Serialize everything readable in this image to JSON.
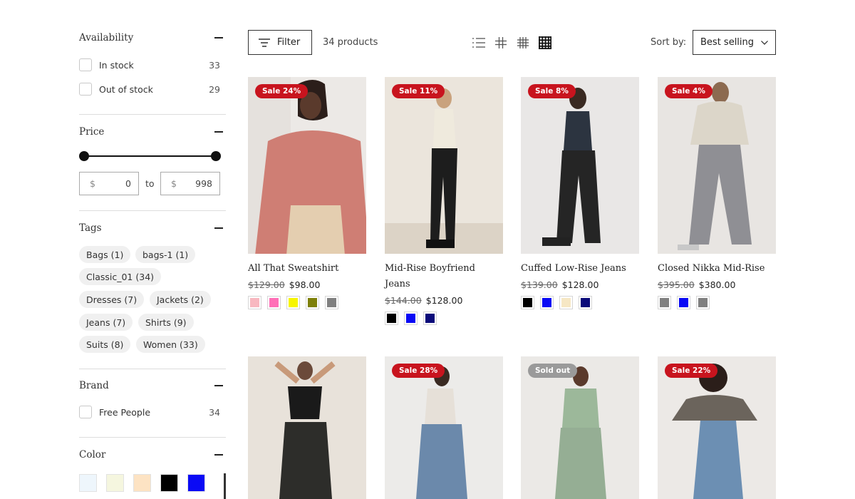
{
  "filters": {
    "availability": {
      "title": "Availability",
      "options": [
        {
          "label": "In stock",
          "count": "33"
        },
        {
          "label": "Out of stock",
          "count": "29"
        }
      ]
    },
    "price": {
      "title": "Price",
      "currency": "$",
      "min": "0",
      "max": "998",
      "to_label": "to"
    },
    "tags": {
      "title": "Tags",
      "items": [
        "Bags (1)",
        "bags-1 (1)",
        "Classic_01 (34)",
        "Dresses (7)",
        "Jackets (2)",
        "Jeans (7)",
        "Shirts (9)",
        "Suits (8)",
        "Women (33)"
      ]
    },
    "brand": {
      "title": "Brand",
      "options": [
        {
          "label": "Free People",
          "count": "34"
        }
      ]
    },
    "color": {
      "title": "Color",
      "swatches": [
        "#eef6fc",
        "#f5f6df",
        "#fde3c3",
        "#000000",
        "#0a0af5"
      ]
    }
  },
  "toolbar": {
    "filter_label": "Filter",
    "product_count": "34 products",
    "sort_label": "Sort by:",
    "sort_value": "Best selling",
    "view_icons": [
      "list-view-icon",
      "grid-2-icon",
      "grid-3-icon",
      "grid-4-icon"
    ]
  },
  "products": [
    {
      "badge": "Sale 24%",
      "title": "All That Sweatshirt",
      "old_price": "$129.00",
      "price": "$98.00",
      "swatches": [
        "#f8b8c0",
        "#ff6fb7",
        "#f7f500",
        "#7e800a",
        "#808080"
      ]
    },
    {
      "badge": "Sale 11%",
      "title": "Mid-Rise Boyfriend Jeans",
      "old_price": "$144.00",
      "price": "$128.00",
      "swatches": [
        "#000000",
        "#0a0af5",
        "#0b0b7a"
      ]
    },
    {
      "badge": "Sale 8%",
      "title": "Cuffed Low-Rise Jeans",
      "old_price": "$139.00",
      "price": "$128.00",
      "swatches": [
        "#000000",
        "#0a0af5",
        "#f6e7c4",
        "#0b0b7a"
      ]
    },
    {
      "badge": "Sale 4%",
      "title": "Closed Nikka Mid-Rise",
      "old_price": "$395.00",
      "price": "$380.00",
      "swatches": [
        "#808080",
        "#0a0af5",
        "#808080"
      ]
    },
    {
      "badge": "",
      "title": "",
      "old_price": "",
      "price": "",
      "swatches": []
    },
    {
      "badge": "Sale 28%",
      "title": "",
      "old_price": "",
      "price": "",
      "swatches": []
    },
    {
      "badge": "Sold out",
      "title": "",
      "old_price": "",
      "price": "",
      "swatches": []
    },
    {
      "badge": "Sale 22%",
      "title": "",
      "old_price": "",
      "price": "",
      "swatches": []
    }
  ]
}
